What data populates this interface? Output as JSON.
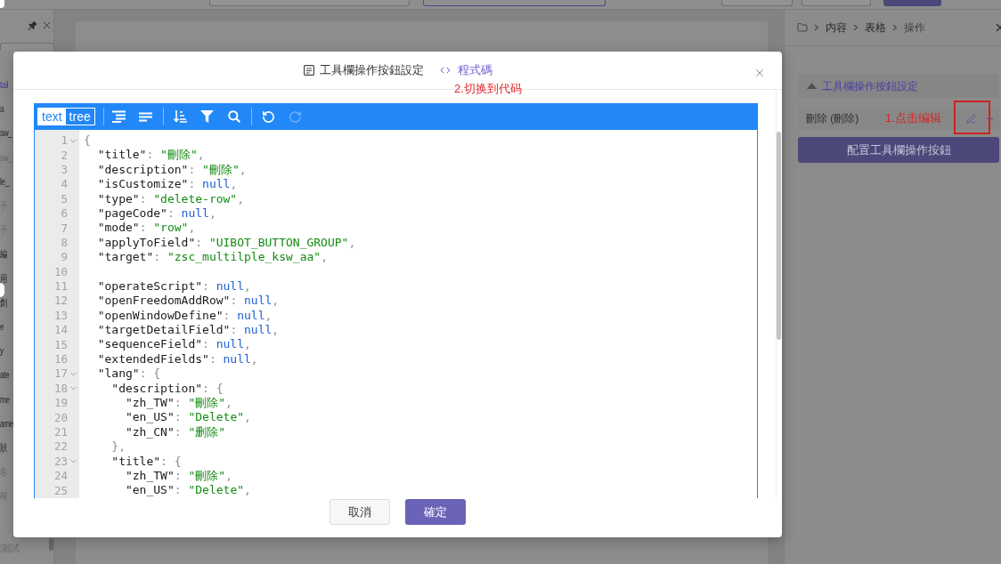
{
  "top_bar": {
    "left_buttons": [
      {
        "kind": "outline"
      },
      {
        "kind": "accent-outline"
      }
    ],
    "right_buttons": [
      {
        "kind": "outline"
      },
      {
        "kind": "outline"
      },
      {
        "kind": "accent"
      }
    ]
  },
  "sidebar": {
    "items": [
      {
        "label": "tail",
        "selected": true,
        "disabled": false
      },
      {
        "label": "a",
        "selected": false,
        "disabled": false
      },
      {
        "label": "sw_",
        "selected": false,
        "disabled": false
      },
      {
        "label": "sw_",
        "selected": false,
        "disabled": true
      },
      {
        "label": "le_",
        "selected": false,
        "disabled": false
      },
      {
        "label": "子",
        "selected": false,
        "disabled": true
      },
      {
        "label": "子",
        "selected": false,
        "disabled": true
      },
      {
        "label": "編",
        "selected": false,
        "disabled": false
      },
      {
        "label": "用",
        "selected": false,
        "disabled": false
      },
      {
        "label": "創",
        "selected": false,
        "disabled": false
      },
      {
        "label": "e",
        "selected": false,
        "disabled": false
      },
      {
        "label": "y",
        "selected": false,
        "disabled": false
      },
      {
        "label": "ate",
        "selected": false,
        "disabled": false
      },
      {
        "label": "me",
        "selected": false,
        "disabled": false
      },
      {
        "label": "ame",
        "selected": false,
        "disabled": false
      },
      {
        "label": "狀",
        "selected": false,
        "disabled": false
      },
      {
        "label": "名",
        "selected": false,
        "disabled": true
      },
      {
        "label": "稱",
        "selected": false,
        "disabled": true
      }
    ],
    "footer_item": {
      "label": "測試",
      "disabled": true
    }
  },
  "right_panel": {
    "breadcrumb": [
      "内容",
      "表格",
      "操作"
    ],
    "section": {
      "title": "工具欄操作按鈕設定",
      "expanded": true,
      "rows": [
        {
          "label": "刪除 (刪除)"
        }
      ]
    },
    "annotation": "1.点击编辑",
    "config_button": "配置工具欄操作按鈕"
  },
  "dialog": {
    "title": "工具欄操作按鈕設定",
    "view_toggle": "程式碼",
    "annotation": "2.切换到代码",
    "editor": {
      "modes": [
        {
          "label": "text",
          "selected": true
        },
        {
          "label": "tree",
          "selected": false
        }
      ],
      "toolbar": [
        {
          "kind": "format",
          "disabled": false
        },
        {
          "kind": "compact",
          "disabled": false
        },
        {
          "kind": "separator"
        },
        {
          "kind": "sort",
          "disabled": false
        },
        {
          "kind": "filter",
          "disabled": false
        },
        {
          "kind": "search",
          "disabled": false
        },
        {
          "kind": "separator"
        },
        {
          "kind": "undo",
          "disabled": false
        },
        {
          "kind": "redo",
          "disabled": true
        }
      ],
      "lines": [
        {
          "number": "1",
          "code": "{",
          "foldable": true
        },
        {
          "number": "2",
          "code": "  \"title\": \"刪除\",",
          "foldable": false
        },
        {
          "number": "3",
          "code": "  \"description\": \"刪除\",",
          "foldable": false
        },
        {
          "number": "4",
          "code": "  \"isCustomize\": null,",
          "foldable": false
        },
        {
          "number": "5",
          "code": "  \"type\": \"delete-row\",",
          "foldable": false
        },
        {
          "number": "6",
          "code": "  \"pageCode\": null,",
          "foldable": false
        },
        {
          "number": "7",
          "code": "  \"mode\": \"row\",",
          "foldable": false
        },
        {
          "number": "8",
          "code": "  \"applyToField\": \"UIBOT_BUTTON_GROUP\",",
          "foldable": false
        },
        {
          "number": "9",
          "code": "  \"target\": \"zsc_multilple_ksw_aa\",",
          "foldable": false
        },
        {
          "number": "10",
          "foldable": false
        },
        {
          "number": "11",
          "code": "  \"operateScript\": null,",
          "foldable": false
        },
        {
          "number": "12",
          "code": "  \"openFreedomAddRow\": null,",
          "foldable": false
        },
        {
          "number": "13",
          "code": "  \"openWindowDefine\": null,",
          "foldable": false
        },
        {
          "number": "14",
          "code": "  \"targetDetailField\": null,",
          "foldable": false
        },
        {
          "number": "15",
          "code": "  \"sequenceField\": null,",
          "foldable": false
        },
        {
          "number": "16",
          "code": "  \"extendedFields\": null,",
          "foldable": false
        },
        {
          "number": "17",
          "code": "  \"lang\": {",
          "foldable": true
        },
        {
          "number": "18",
          "code": "    \"description\": {",
          "foldable": true
        },
        {
          "number": "19",
          "code": "      \"zh_TW\": \"刪除\",",
          "foldable": false
        },
        {
          "number": "20",
          "code": "      \"en_US\": \"Delete\",",
          "foldable": false
        },
        {
          "number": "21",
          "code": "      \"zh_CN\": \"删除\"",
          "foldable": false
        },
        {
          "number": "22",
          "code": "    },",
          "foldable": false
        },
        {
          "number": "23",
          "code": "    \"title\": {",
          "foldable": true
        },
        {
          "number": "24",
          "code": "      \"zh_TW\": \"刪除\",",
          "foldable": false
        },
        {
          "number": "25",
          "code": "      \"en_US\": \"Delete\",",
          "foldable": false
        }
      ]
    },
    "buttons": [
      {
        "label": "取消",
        "kind": "secondary"
      },
      {
        "label": "確定",
        "kind": "primary"
      }
    ]
  }
}
